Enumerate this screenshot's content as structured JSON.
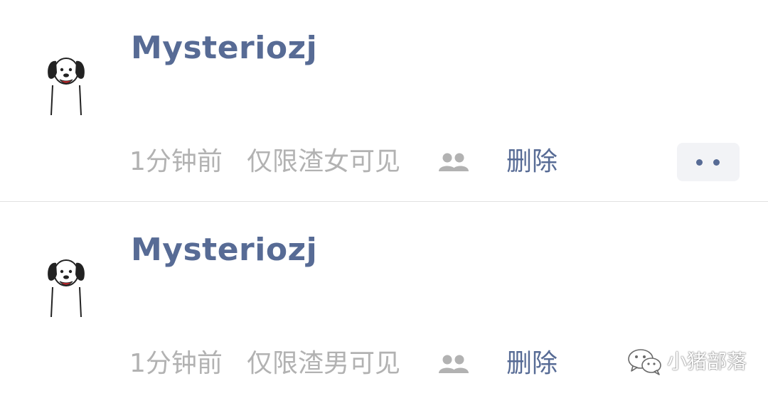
{
  "posts": [
    {
      "username": "Mysteriozj",
      "time": "1分钟前",
      "visibility": "仅限渣女可见",
      "delete_label": "删除",
      "has_more_button": true
    },
    {
      "username": "Mysteriozj",
      "time": "1分钟前",
      "visibility": "仅限渣男可见",
      "delete_label": "删除",
      "has_more_button": false
    }
  ],
  "watermark": {
    "text": "小猪部落"
  },
  "colors": {
    "link": "#576b95",
    "meta": "#b2b2b2",
    "divider": "#e2e2e2",
    "more_button_bg": "#f2f3f6"
  },
  "icons": {
    "avatar": "cartoon-dog-icon",
    "visibility_group": "group-icon",
    "more": "more-dots-icon",
    "watermark": "wechat-icon"
  }
}
